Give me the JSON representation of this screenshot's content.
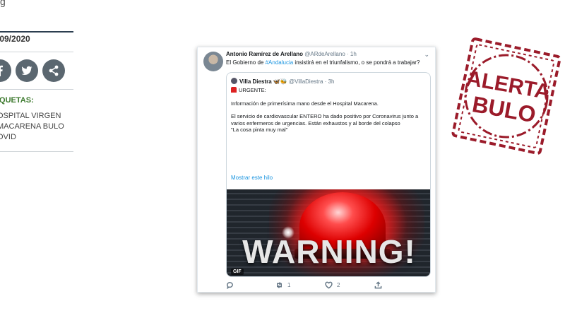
{
  "sidebar": {
    "date": "/09/2020",
    "tags_heading": "IQUETAS:",
    "tags": [
      "OSPITAL VIRGEN",
      "MACARENA BULO",
      "OVID"
    ],
    "share": [
      {
        "icon": "facebook-icon"
      },
      {
        "icon": "twitter-icon"
      },
      {
        "icon": "share-icon"
      }
    ]
  },
  "tweet": {
    "author_name": "Antonio Ramírez de Arellano",
    "author_handle": "@ARdeArellano",
    "time": "· 1h",
    "text_before": "El Gobierno de ",
    "hashtag": "#Andalucia",
    "text_after": " insistirá en el triunfalismo, o se pondrá a trabajar?",
    "quote": {
      "author_name": "Villa Diestra",
      "author_emoji": "🦋🐝",
      "author_handle": "@VillaDiestra · 3h",
      "urgent": "URGENTE:",
      "line1": "Información de primerísima mano desde el Hospital Macarena.",
      "line2": "El servicio de cardiovascular ENTERO ha dado positivo por Coronavirus junto a varios enfermeros de urgencias. Están exhaustos y al borde del colapso",
      "line3": "\"La cosa pinta muy mal\"",
      "show_thread": "Mostrar este hilo",
      "gif_text": "WARNING!",
      "gif_badge": "GIF"
    },
    "actions": {
      "reply": "",
      "retweet": "1",
      "like": "2",
      "share": ""
    }
  },
  "stamp": {
    "line1": "ALERTA",
    "line2": "BULO",
    "color": "#9b1b2a"
  }
}
